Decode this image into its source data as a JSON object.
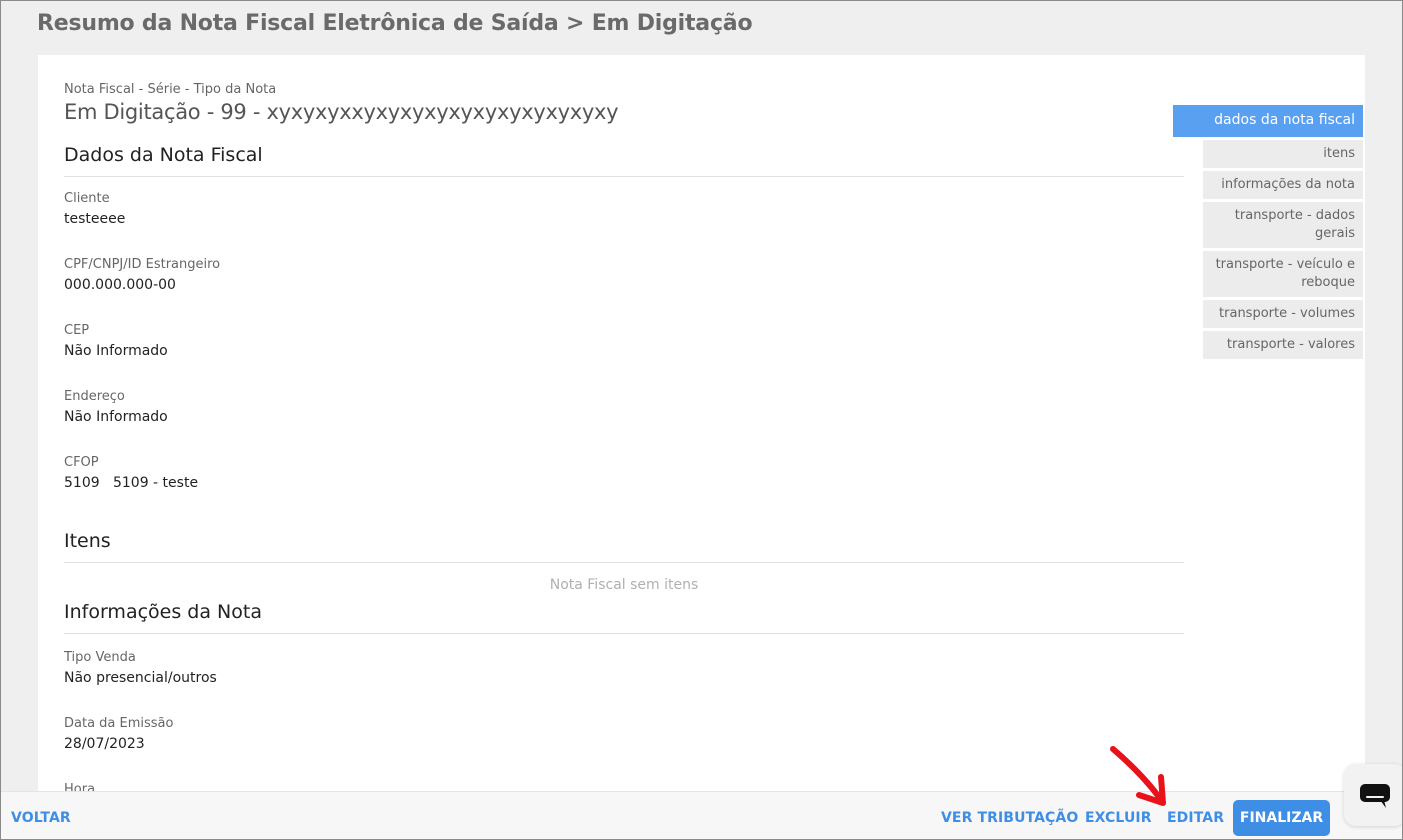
{
  "page": {
    "title": "Resumo da Nota Fiscal Eletrônica de Saída > Em Digitação"
  },
  "header": {
    "label": "Nota Fiscal - Série - Tipo da Nota",
    "title": "Em Digitação - 99 - xyxyxyxxyxyxyxyxyxyxyxyxyxyxy"
  },
  "sections": {
    "dados": {
      "title": "Dados da Nota Fiscal",
      "fields": [
        {
          "label": "Cliente",
          "value": "testeeee"
        },
        {
          "label": "CPF/CNPJ/ID Estrangeiro",
          "value": "000.000.000-00"
        },
        {
          "label": "CEP",
          "value": "Não Informado"
        },
        {
          "label": "Endereço",
          "value": "Não Informado"
        },
        {
          "label": "CFOP",
          "value": "5109   5109 - teste"
        }
      ]
    },
    "itens": {
      "title": "Itens",
      "empty": "Nota Fiscal sem itens"
    },
    "info": {
      "title": "Informações da Nota",
      "fields": [
        {
          "label": "Tipo Venda",
          "value": "Não presencial/outros"
        },
        {
          "label": "Data da Emissão",
          "value": "28/07/2023"
        },
        {
          "label": "Hora",
          "value": ""
        }
      ]
    }
  },
  "sidebar": {
    "active": "dados da nota fiscal",
    "items": [
      "itens",
      "informações da nota",
      "transporte - dados gerais",
      "transporte - veículo e reboque",
      "transporte - volumes",
      "transporte - valores"
    ]
  },
  "actions": {
    "back": "VOLTAR",
    "tributacao": "VER TRIBUTAÇÃO",
    "excluir": "EXCLUIR",
    "editar": "EDITAR",
    "finalizar": "FINALIZAR"
  },
  "colors": {
    "accent": "#3f8ee6",
    "sidebar_active": "#5aa0f0",
    "annotation_arrow": "#e8121b"
  },
  "icons": {
    "chat": "chat-bubble-icon",
    "annotation": "red-arrow-annotation"
  }
}
